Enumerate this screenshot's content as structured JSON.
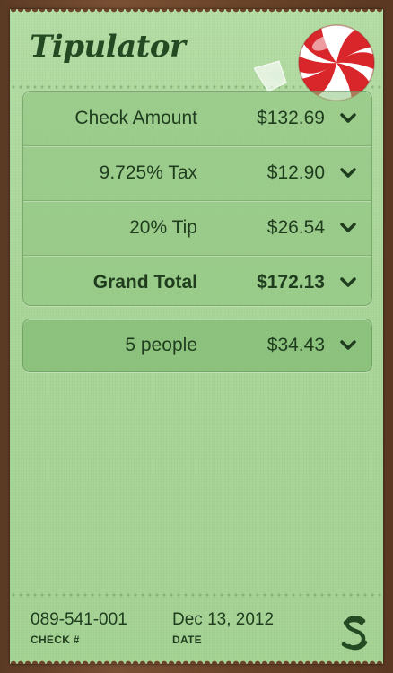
{
  "app": {
    "title": "Tipulator"
  },
  "bill": {
    "rows": [
      {
        "label": "Check Amount",
        "value": "$132.69"
      },
      {
        "label": "9.725% Tax",
        "value": "$12.90"
      },
      {
        "label": "20% Tip",
        "value": "$26.54"
      },
      {
        "label": "Grand Total",
        "value": "$172.13"
      }
    ]
  },
  "split": {
    "label": "5 people",
    "value": "$34.43"
  },
  "footer": {
    "check_number": "089-541-001",
    "check_caption": "CHECK #",
    "date": "Dec 13, 2012",
    "date_caption": "DATE"
  },
  "colors": {
    "paper": "#a9d598",
    "text": "#1f3d1e",
    "wood": "#6a4429",
    "candy_red": "#d8262b"
  },
  "icons": {
    "row_expand": "chevron-down-icon",
    "candy": "peppermint-candy-icon",
    "signature": "script-s-icon"
  }
}
